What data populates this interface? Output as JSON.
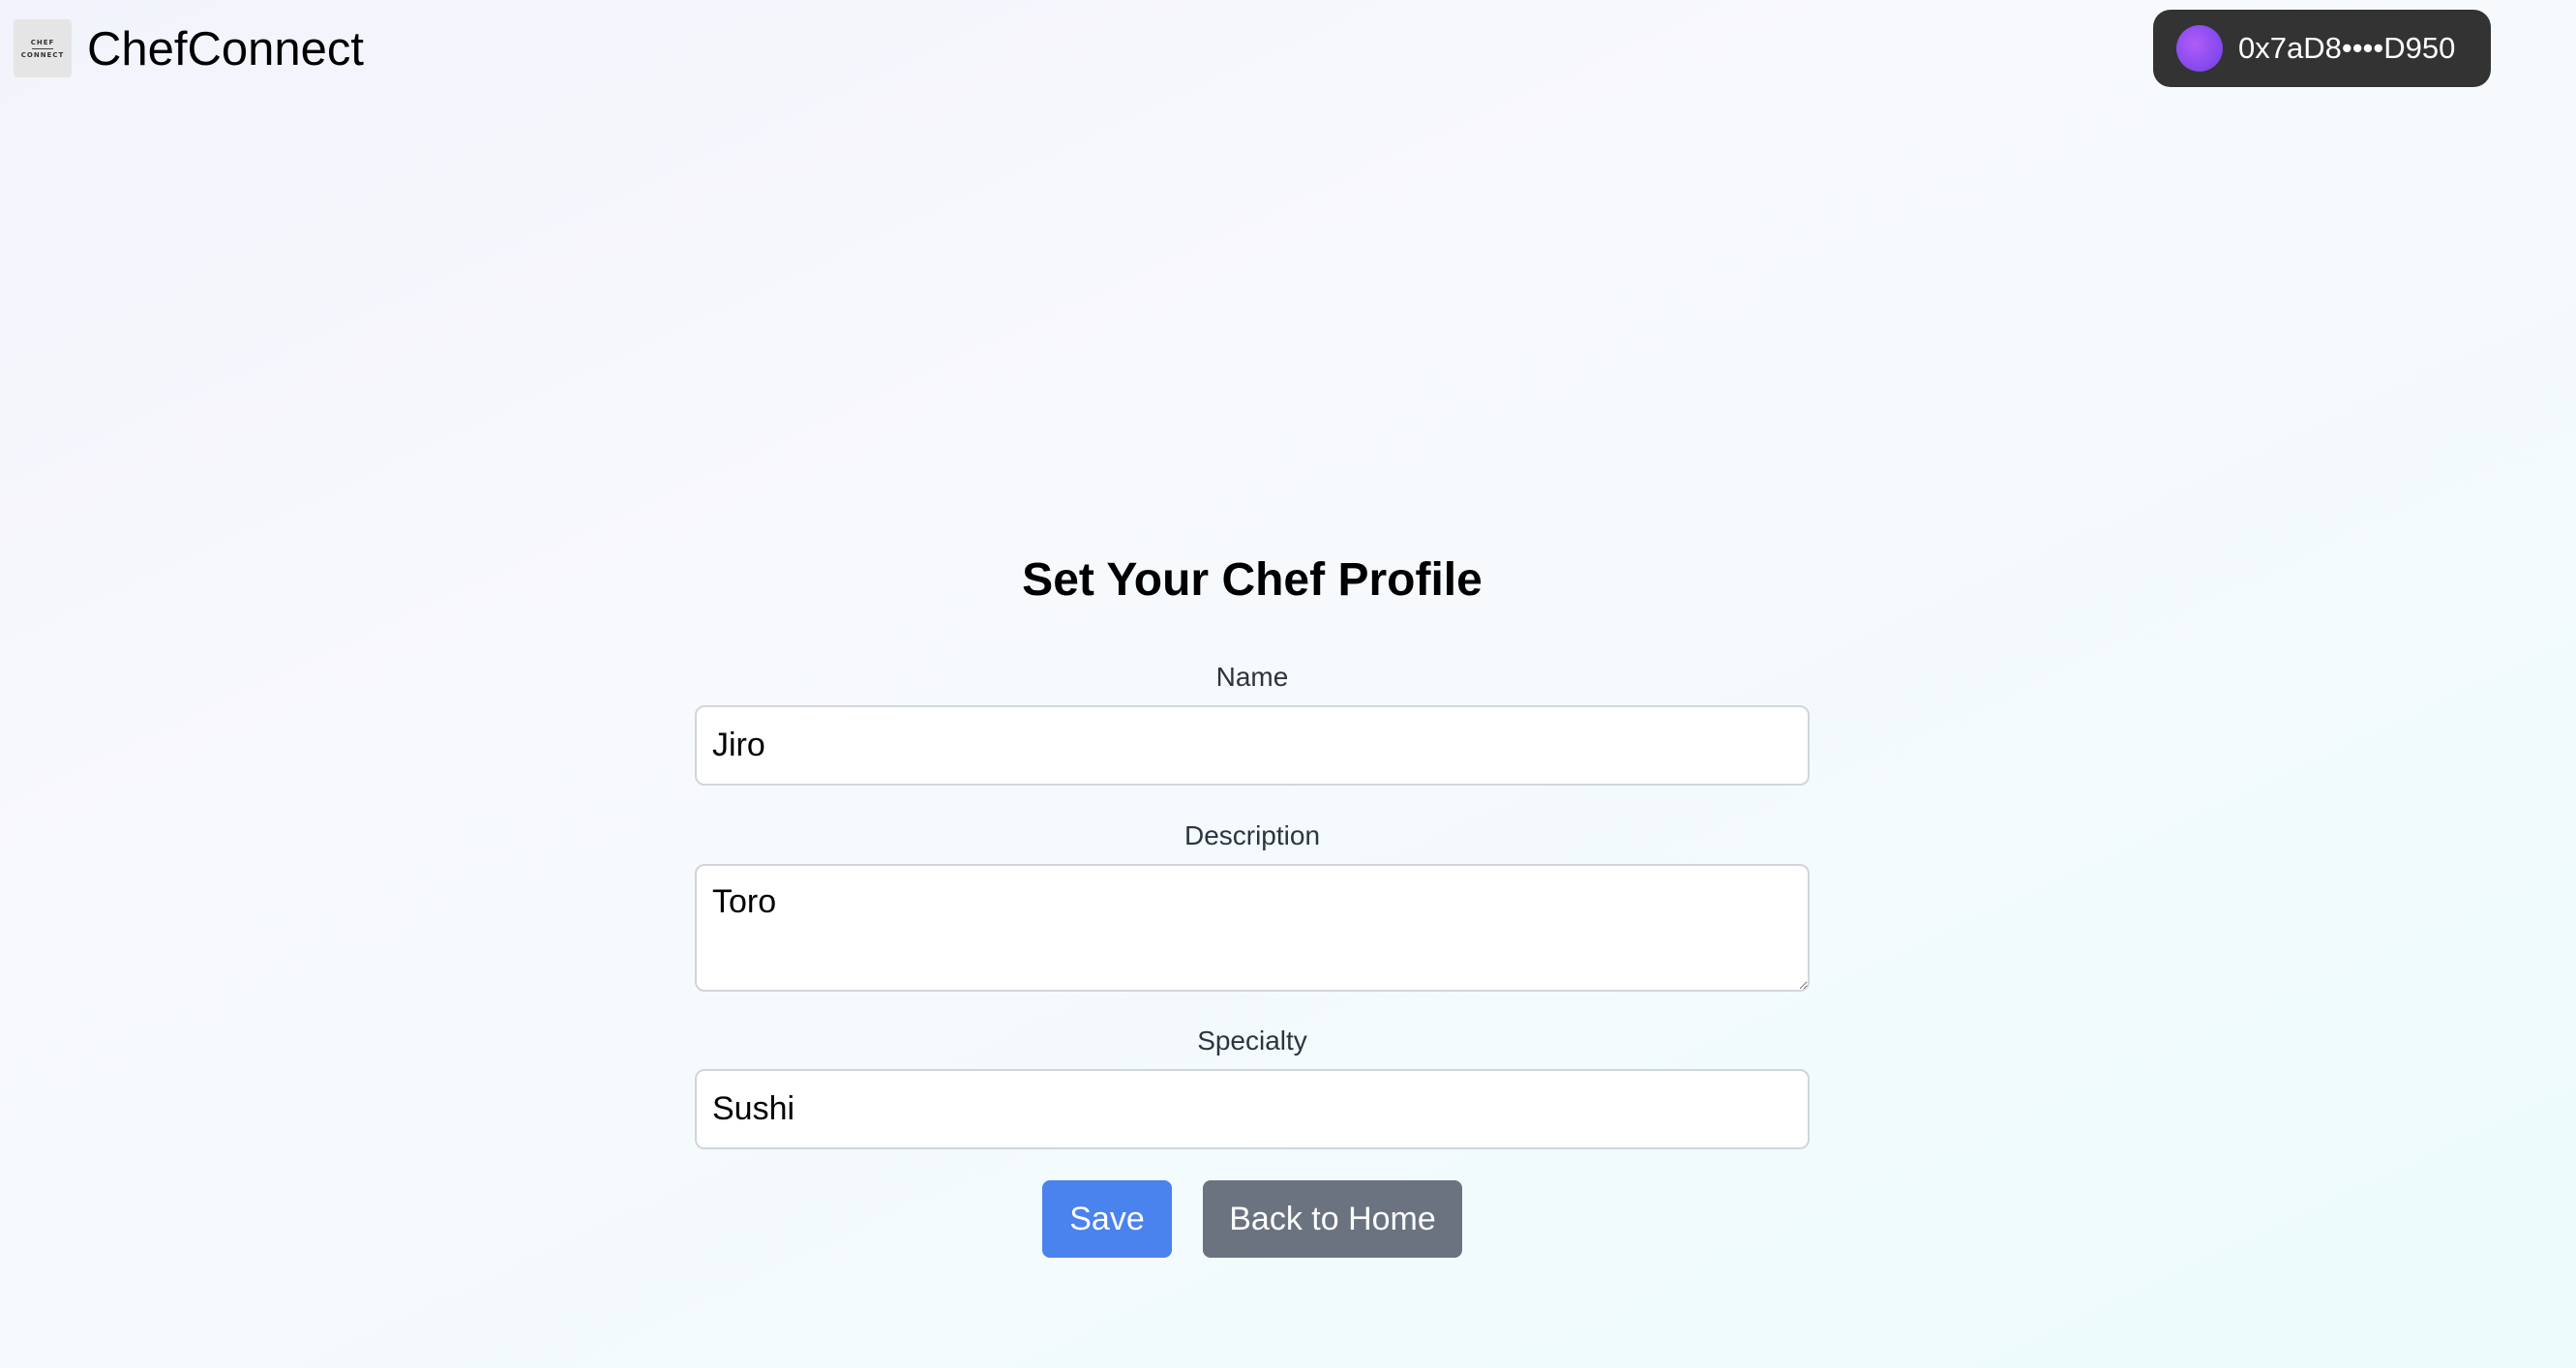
{
  "header": {
    "logo_text_top": "CHEF",
    "logo_text_bottom": "CONNECT",
    "app_title": "ChefConnect",
    "wallet": {
      "address": "0x7aD8••••D950",
      "avatar_color": "#8b4cf0"
    }
  },
  "form": {
    "title": "Set Your Chef Profile",
    "name": {
      "label": "Name",
      "value": "Jiro"
    },
    "description": {
      "label": "Description",
      "value": "Toro"
    },
    "specialty": {
      "label": "Specialty",
      "value": "Sushi"
    },
    "save_label": "Save",
    "back_label": "Back to Home"
  },
  "colors": {
    "save_button": "#4a82ee",
    "back_button": "#6b7280",
    "wallet_bg": "#333333"
  }
}
